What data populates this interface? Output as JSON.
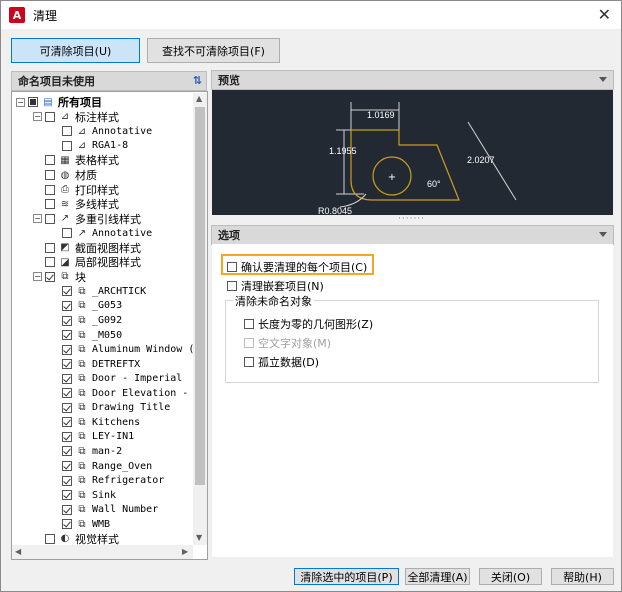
{
  "window": {
    "title": "清理",
    "app_icon": "A"
  },
  "tabs": [
    {
      "label": "可清除项目(U)",
      "active": true
    },
    {
      "label": "查找不可清除项目(F)",
      "active": false
    }
  ],
  "left_pane": {
    "title": "命名项目未使用"
  },
  "tree": [
    {
      "level": 0,
      "label": "所有项目",
      "expander": "−",
      "check": "partial",
      "icon": "allitems-icon",
      "bold": true
    },
    {
      "level": 1,
      "label": "标注样式",
      "expander": "−",
      "check": "none",
      "icon": "dimstyle-icon"
    },
    {
      "level": 2,
      "label": "Annotative",
      "check": "none",
      "icon": "dimstyle-icon",
      "mono": true
    },
    {
      "level": 2,
      "label": "RGA1-8",
      "check": "none",
      "icon": "dimstyle-icon",
      "mono": true
    },
    {
      "level": 1,
      "label": "表格样式",
      "check": "none",
      "icon": "table-icon"
    },
    {
      "level": 1,
      "label": "材质",
      "check": "none",
      "icon": "material-icon"
    },
    {
      "level": 1,
      "label": "打印样式",
      "check": "none",
      "icon": "plot-icon"
    },
    {
      "level": 1,
      "label": "多线样式",
      "check": "none",
      "icon": "mline-icon"
    },
    {
      "level": 1,
      "label": "多重引线样式",
      "expander": "−",
      "check": "none",
      "icon": "mleader-icon"
    },
    {
      "level": 2,
      "label": "Annotative",
      "check": "none",
      "icon": "mleader-icon",
      "mono": true
    },
    {
      "level": 1,
      "label": "截面视图样式",
      "check": "none",
      "icon": "section-icon"
    },
    {
      "level": 1,
      "label": "局部视图样式",
      "check": "none",
      "icon": "detail-icon"
    },
    {
      "level": 1,
      "label": "块",
      "expander": "−",
      "check": "checked",
      "icon": "block-icon"
    },
    {
      "level": 2,
      "label": "_ARCHTICK",
      "check": "checked",
      "icon": "block-icon",
      "mono": true
    },
    {
      "level": 2,
      "label": "_G053",
      "check": "checked",
      "icon": "block-icon",
      "mono": true
    },
    {
      "level": 2,
      "label": "_G092",
      "check": "checked",
      "icon": "block-icon",
      "mono": true
    },
    {
      "level": 2,
      "label": "_M050",
      "check": "checked",
      "icon": "block-icon",
      "mono": true
    },
    {
      "level": 2,
      "label": "Aluminum Window (",
      "check": "checked",
      "icon": "block-icon",
      "mono": true
    },
    {
      "level": 2,
      "label": "DETREFTX",
      "check": "checked",
      "icon": "block-icon",
      "mono": true
    },
    {
      "level": 2,
      "label": "Door - Imperial",
      "check": "checked",
      "icon": "block-icon",
      "mono": true
    },
    {
      "level": 2,
      "label": "Door Elevation -",
      "check": "checked",
      "icon": "block-icon",
      "mono": true
    },
    {
      "level": 2,
      "label": "Drawing Title",
      "check": "checked",
      "icon": "block-icon",
      "mono": true
    },
    {
      "level": 2,
      "label": "Kitchens",
      "check": "checked",
      "icon": "block-icon",
      "mono": true
    },
    {
      "level": 2,
      "label": "LEY-IN1",
      "check": "checked",
      "icon": "block-icon",
      "mono": true
    },
    {
      "level": 2,
      "label": "man-2",
      "check": "checked",
      "icon": "block-icon",
      "mono": true
    },
    {
      "level": 2,
      "label": "Range_Oven",
      "check": "checked",
      "icon": "block-icon",
      "mono": true
    },
    {
      "level": 2,
      "label": "Refrigerator",
      "check": "checked",
      "icon": "block-icon",
      "mono": true
    },
    {
      "level": 2,
      "label": "Sink",
      "check": "checked",
      "icon": "block-icon",
      "mono": true
    },
    {
      "level": 2,
      "label": "Wall Number",
      "check": "checked",
      "icon": "block-icon",
      "mono": true
    },
    {
      "level": 2,
      "label": "WMB",
      "check": "checked",
      "icon": "block-icon",
      "mono": true
    },
    {
      "level": 1,
      "label": "视觉样式",
      "check": "none",
      "icon": "visualstyle-icon"
    }
  ],
  "preview": {
    "title": "预览",
    "dims": {
      "top": "1.0169",
      "left": "1.1955",
      "right": "2.0207",
      "angle": "60°",
      "radius": "R0.8045"
    }
  },
  "options": {
    "title": "选项",
    "confirm": {
      "label": "确认要清理的每个项目(C)",
      "checked": false
    },
    "nested": {
      "label": "清理嵌套项目(N)",
      "checked": false
    },
    "group_title": "清除未命名对象",
    "zero_len": {
      "label": "长度为零的几何图形(Z)",
      "checked": false
    },
    "empty_text": {
      "label": "空文字对象(M)",
      "checked": false,
      "disabled": true
    },
    "orphan": {
      "label": "孤立数据(D)",
      "checked": false
    }
  },
  "buttons": {
    "purge_selected": "清除选中的项目(P)",
    "purge_all": "全部清理(A)",
    "close": "关闭(O)",
    "help": "帮助(H)"
  },
  "colors": {
    "accent": "#0078d7",
    "highlight": "#f5a623",
    "preview_bg": "#222933",
    "geometry": "#c8a020"
  }
}
